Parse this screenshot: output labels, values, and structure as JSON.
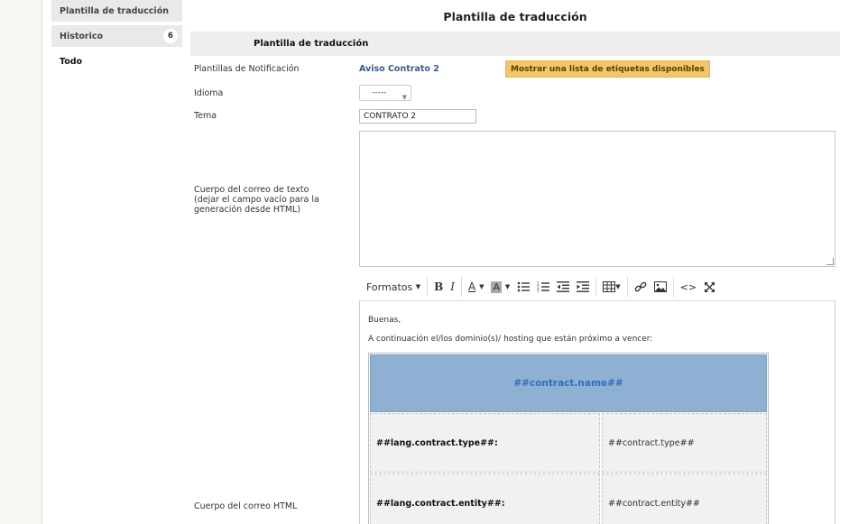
{
  "sidebar": {
    "items": [
      {
        "label": "Plantilla de traducción"
      },
      {
        "label": "Historico",
        "count": "6"
      },
      {
        "label": "Todo"
      }
    ]
  },
  "page": {
    "title": "Plantilla de traducción",
    "section_title": "Plantilla de traducción"
  },
  "form": {
    "template_label": "Plantillas de Notificación",
    "template_value": "Aviso Contrato 2",
    "show_tags_button": "Mostrar una lista de etiquetas disponibles",
    "language_label": "Idioma",
    "language_value": "-----",
    "subject_label": "Tema",
    "subject_value": "CONTRATO 2",
    "text_body_label_1": "Cuerpo del correo de texto",
    "text_body_label_2": "(dejar el campo vacío para la",
    "text_body_label_3": "generación desde HTML)",
    "html_body_label": "Cuerpo del correo HTML"
  },
  "toolbar": {
    "formats_label": "Formatos"
  },
  "editor": {
    "greeting": "Buenas,",
    "intro": "A continuación el/los dominio(s)/ hosting que están próximo a vencer:",
    "table_header": "##contract.name##",
    "rows": [
      {
        "key": "##lang.contract.type##:",
        "value": "##contract.type##"
      },
      {
        "key": "##lang.contract.entity##:",
        "value": "##contract.entity##"
      }
    ]
  },
  "colors": {
    "tag_button_bg": "#f3c66a",
    "table_header_bg": "#8eb0d2",
    "link": "#3a5b8c"
  }
}
